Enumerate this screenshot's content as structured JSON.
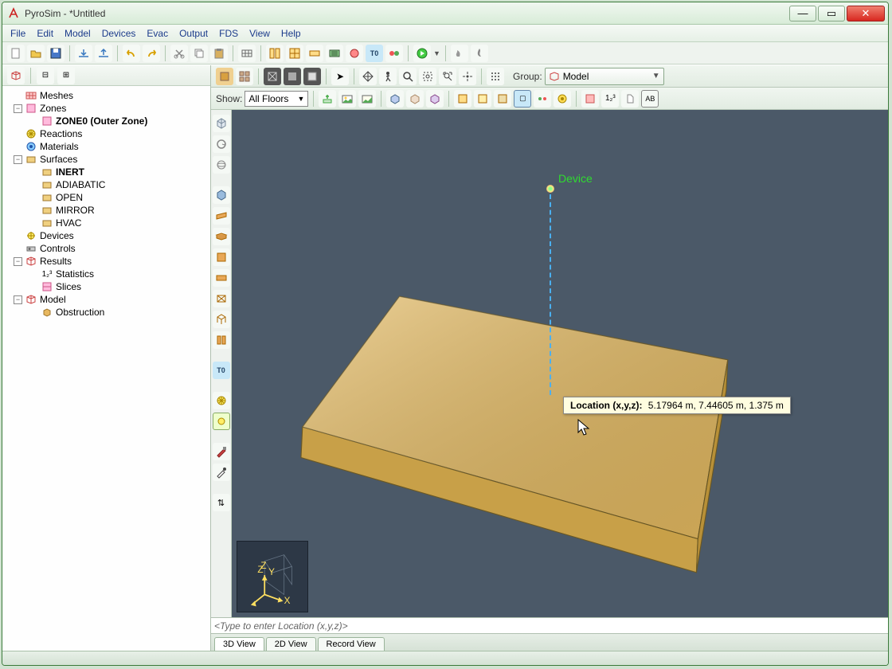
{
  "window": {
    "title": "PyroSim - *Untitled"
  },
  "menu": [
    "File",
    "Edit",
    "Model",
    "Devices",
    "Evac",
    "Output",
    "FDS",
    "View",
    "Help"
  ],
  "toolbar_icons": [
    "new",
    "open",
    "save",
    "import",
    "export",
    "undo",
    "redo",
    "cut",
    "copy",
    "paste",
    "",
    "mesh",
    "split",
    "refine",
    "merge",
    "vent",
    "surf",
    "t0",
    "fds",
    "run",
    "stop",
    "smoke",
    "flame"
  ],
  "tree": [
    {
      "d": 0,
      "tog": "",
      "ic": "mesh",
      "lbl": "Meshes"
    },
    {
      "d": 0,
      "tog": "-",
      "ic": "zone",
      "lbl": "Zones"
    },
    {
      "d": 1,
      "tog": "",
      "ic": "zone",
      "lbl": "ZONE0 (Outer Zone)",
      "bold": true
    },
    {
      "d": 0,
      "tog": "",
      "ic": "react",
      "lbl": "Reactions"
    },
    {
      "d": 0,
      "tog": "",
      "ic": "mat",
      "lbl": "Materials"
    },
    {
      "d": 0,
      "tog": "-",
      "ic": "surf",
      "lbl": "Surfaces"
    },
    {
      "d": 1,
      "tog": "",
      "ic": "surf",
      "lbl": "INERT",
      "bold": true
    },
    {
      "d": 1,
      "tog": "",
      "ic": "surf",
      "lbl": "ADIABATIC"
    },
    {
      "d": 1,
      "tog": "",
      "ic": "surf",
      "lbl": "OPEN"
    },
    {
      "d": 1,
      "tog": "",
      "ic": "surf",
      "lbl": "MIRROR"
    },
    {
      "d": 1,
      "tog": "",
      "ic": "surf",
      "lbl": "HVAC"
    },
    {
      "d": 0,
      "tog": "",
      "ic": "dev",
      "lbl": "Devices"
    },
    {
      "d": 0,
      "tog": "",
      "ic": "ctrl",
      "lbl": "Controls"
    },
    {
      "d": 0,
      "tog": "-",
      "ic": "res",
      "lbl": "Results"
    },
    {
      "d": 1,
      "tog": "",
      "ic": "stat",
      "lbl": "Statistics"
    },
    {
      "d": 1,
      "tog": "",
      "ic": "slice",
      "lbl": "Slices"
    },
    {
      "d": 0,
      "tog": "-",
      "ic": "model",
      "lbl": "Model"
    },
    {
      "d": 1,
      "tog": "",
      "ic": "obst",
      "lbl": "Obstruction"
    }
  ],
  "view_toolbar": {
    "group_label": "Group:",
    "group_value": "Model",
    "show_label": "Show:",
    "floors": "All Floors"
  },
  "viewport": {
    "device_label": "Device",
    "tooltip_label": "Location (x,y,z):",
    "tooltip_value": "5.17964 m, 7.44605 m, 1.375 m",
    "cmd_placeholder": "<Type to enter Location (x,y,z)>",
    "axes": {
      "x": "X",
      "y": "Y",
      "z": "Z"
    }
  },
  "view_tabs": [
    "3D View",
    "2D View",
    "Record View"
  ],
  "left_tool_icons": [
    "cube",
    "rot",
    "plane",
    "box1",
    "box2",
    "box3",
    "box4",
    "box5",
    "box6",
    "box7",
    "split",
    "t0",
    "star1",
    "star2",
    "paint",
    "brush",
    "pref"
  ]
}
